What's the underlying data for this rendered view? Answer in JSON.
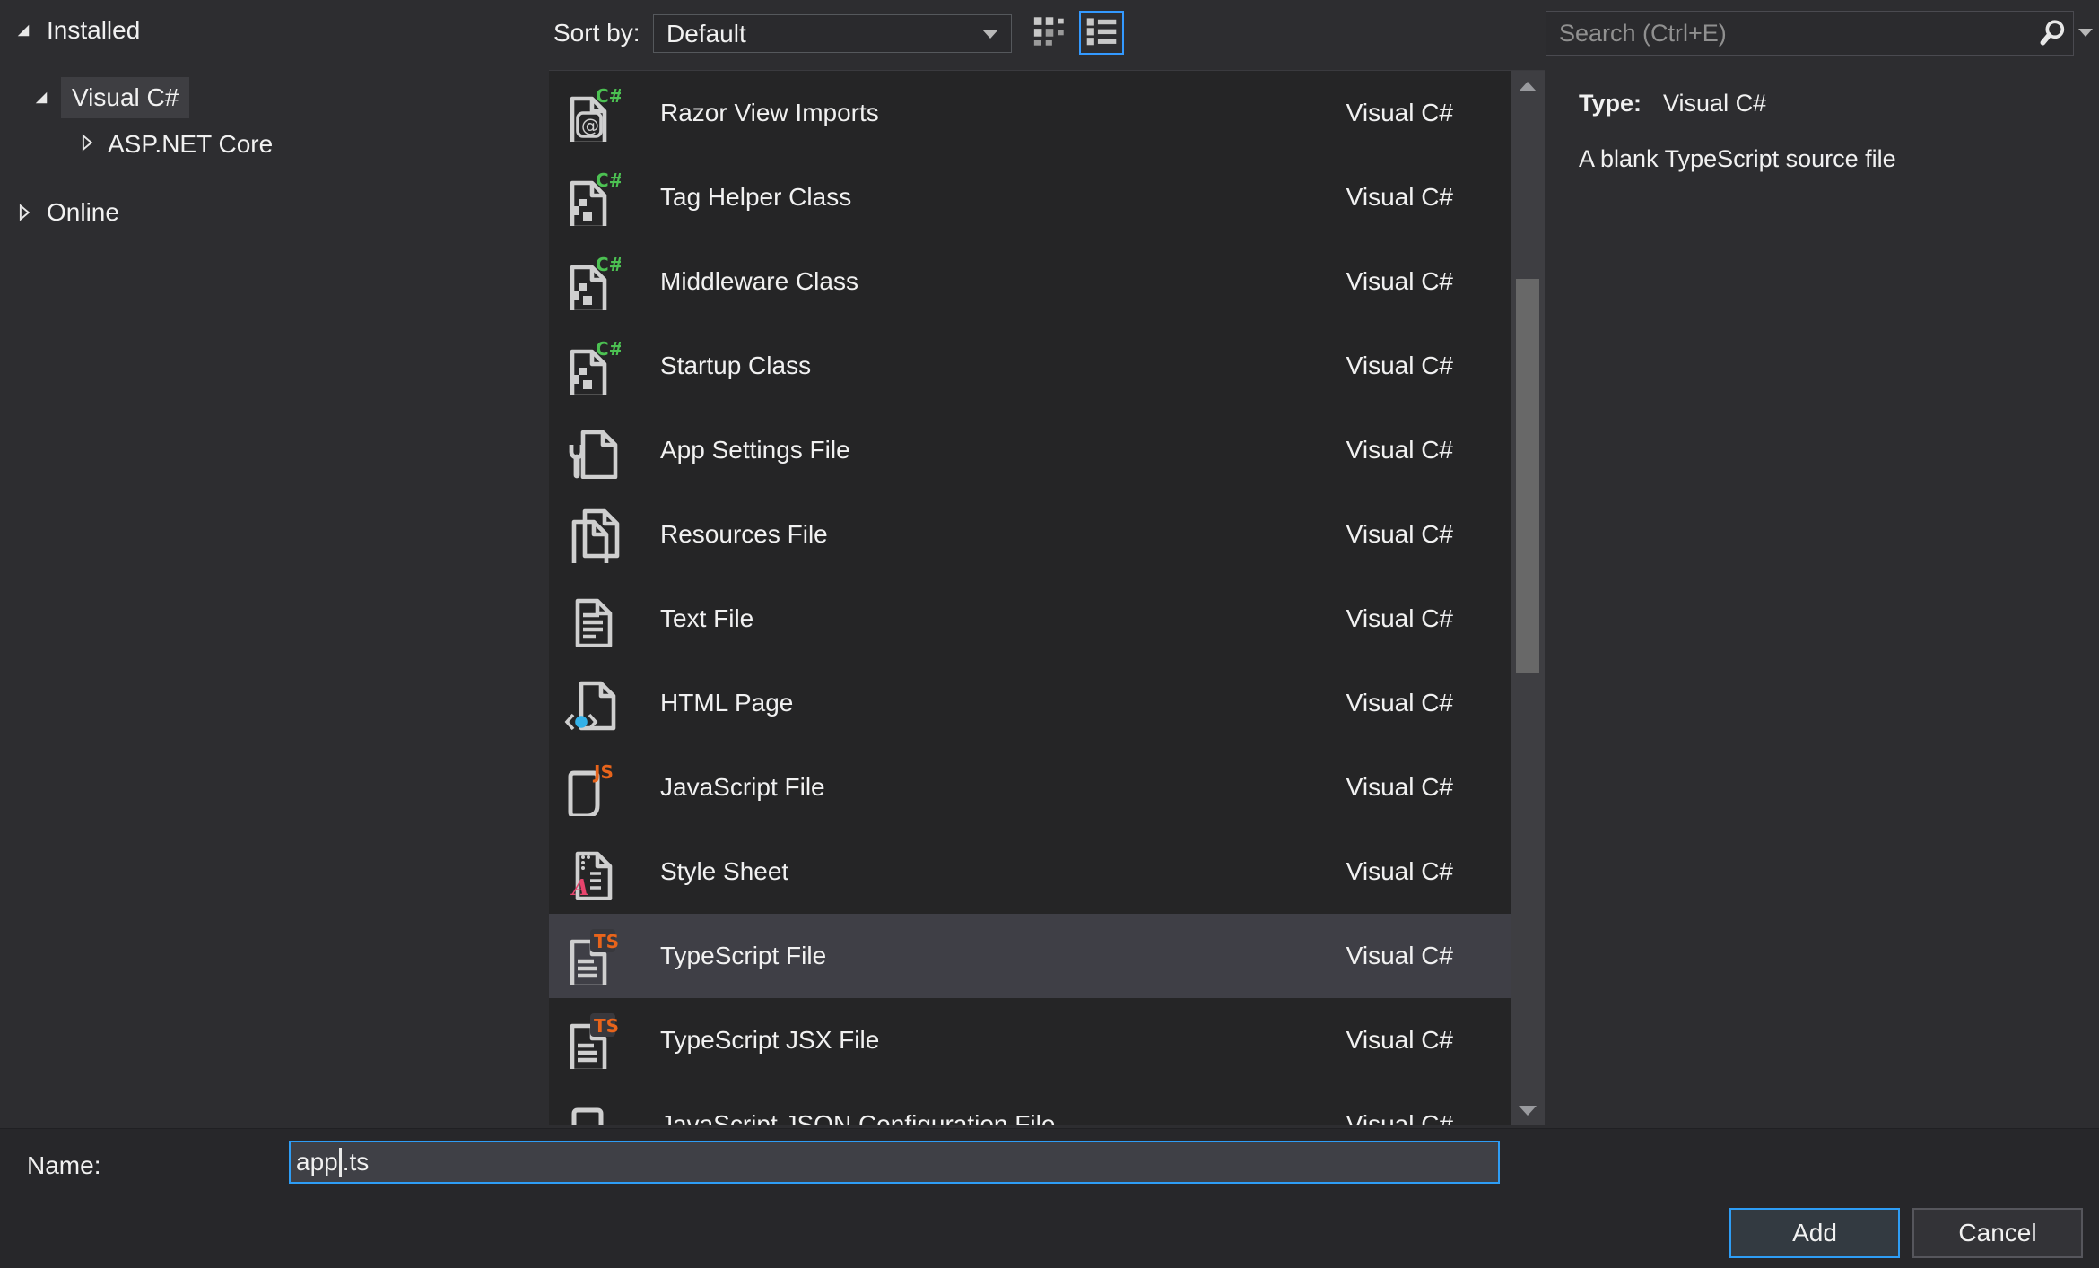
{
  "accent_color": "#3399ff",
  "tree": {
    "installed": "Installed",
    "visual_csharp": "Visual C#",
    "aspnet_core": "ASP.NET Core",
    "online": "Online"
  },
  "toolbar": {
    "sort_by_label": "Sort by:",
    "sort_value": "Default"
  },
  "search": {
    "placeholder": "Search (Ctrl+E)"
  },
  "details": {
    "type_label": "Type:",
    "type_value": "Visual C#",
    "description": "A blank TypeScript source file"
  },
  "list": {
    "items": [
      {
        "label": "Razor View Imports",
        "category": "Visual C#",
        "icon": "razor-csharp-file-icon",
        "selected": false
      },
      {
        "label": "Tag Helper Class",
        "category": "Visual C#",
        "icon": "csharp-class-file-icon",
        "selected": false
      },
      {
        "label": "Middleware Class",
        "category": "Visual C#",
        "icon": "csharp-class-file-icon",
        "selected": false
      },
      {
        "label": "Startup Class",
        "category": "Visual C#",
        "icon": "csharp-class-file-icon",
        "selected": false
      },
      {
        "label": "App Settings File",
        "category": "Visual C#",
        "icon": "app-settings-file-icon",
        "selected": false
      },
      {
        "label": "Resources File",
        "category": "Visual C#",
        "icon": "resources-file-icon",
        "selected": false
      },
      {
        "label": "Text File",
        "category": "Visual C#",
        "icon": "text-file-icon",
        "selected": false
      },
      {
        "label": "HTML Page",
        "category": "Visual C#",
        "icon": "html-page-icon",
        "selected": false
      },
      {
        "label": "JavaScript File",
        "category": "Visual C#",
        "icon": "javascript-file-icon",
        "selected": false
      },
      {
        "label": "Style Sheet",
        "category": "Visual C#",
        "icon": "style-sheet-icon",
        "selected": false
      },
      {
        "label": "TypeScript File",
        "category": "Visual C#",
        "icon": "typescript-file-icon",
        "selected": true
      },
      {
        "label": "TypeScript JSX File",
        "category": "Visual C#",
        "icon": "typescript-file-icon",
        "selected": false
      },
      {
        "label": "JavaScript JSON Configuration File",
        "category": "Visual C#",
        "icon": "json-config-file-icon",
        "selected": false
      }
    ]
  },
  "footer": {
    "name_label": "Name:",
    "name_value_before_caret": "app",
    "name_value_after_caret": ".ts",
    "add_label": "Add",
    "cancel_label": "Cancel"
  }
}
